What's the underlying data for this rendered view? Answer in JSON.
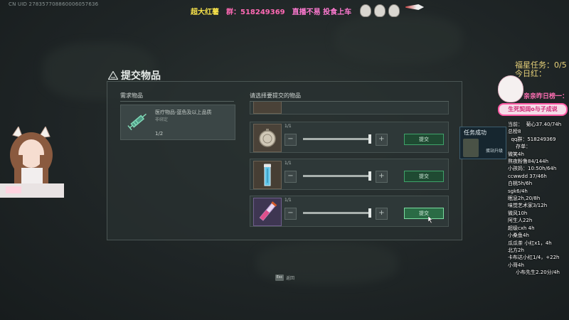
{
  "uid": "CN UID 278357708860006057636",
  "topbar": {
    "t1": "超大红薯",
    "t2": "群：518249369",
    "t3": "直播不易 投食上车"
  },
  "panel": {
    "title": "提交物品",
    "required_header": "需求物品",
    "select_header": "请选择要提交的物品",
    "required_item": {
      "name": "医疗物品-蓝色及以上品质",
      "sub": "非绑定",
      "count": "1/2"
    },
    "rows": [
      {
        "qty": "1/1",
        "submit": "提交"
      },
      {
        "qty": "1/1",
        "submit": "提交"
      },
      {
        "qty": "1/1",
        "submit": "提交"
      }
    ],
    "minus": "−",
    "plus": "+"
  },
  "footer": {
    "esc": "Esc",
    "back": "返回"
  },
  "quest_popup": {
    "title": "任务成功",
    "subtitle": "蛋站升级"
  },
  "overlay": {
    "task_line": "福星任务：0/5",
    "today_line": "今日红：",
    "pink_banner": "亲亲昨日榜一：",
    "pink_badge": "生死契阔o与子成说",
    "donors": "当前：  菊心37.40/74h\n总榜8\n  qq群：518249369\n     存单：\n微笑4h\n熬夜粉鲁84/144h\n小孩妈：10:50h/64h\nccwwdd 37/46h\n白桃5h/6h\nsgk6/4h\n眠息2h,20/8h\n味觉艺术家3/12h\n微风10h\n阿生人22h\n超级cxh 4h\n小桑鱼4h\n瓜瓜茶 小红x1，4h\n北方2h\n卡布达小红1/4，+22h\n小哥4h\n     小布先生2.20分/4h"
  },
  "colors": {
    "accent_green": "#3fa36a",
    "panel_bg": "#283030",
    "pink": "#ff5aa5",
    "gold": "#e8d27a"
  }
}
